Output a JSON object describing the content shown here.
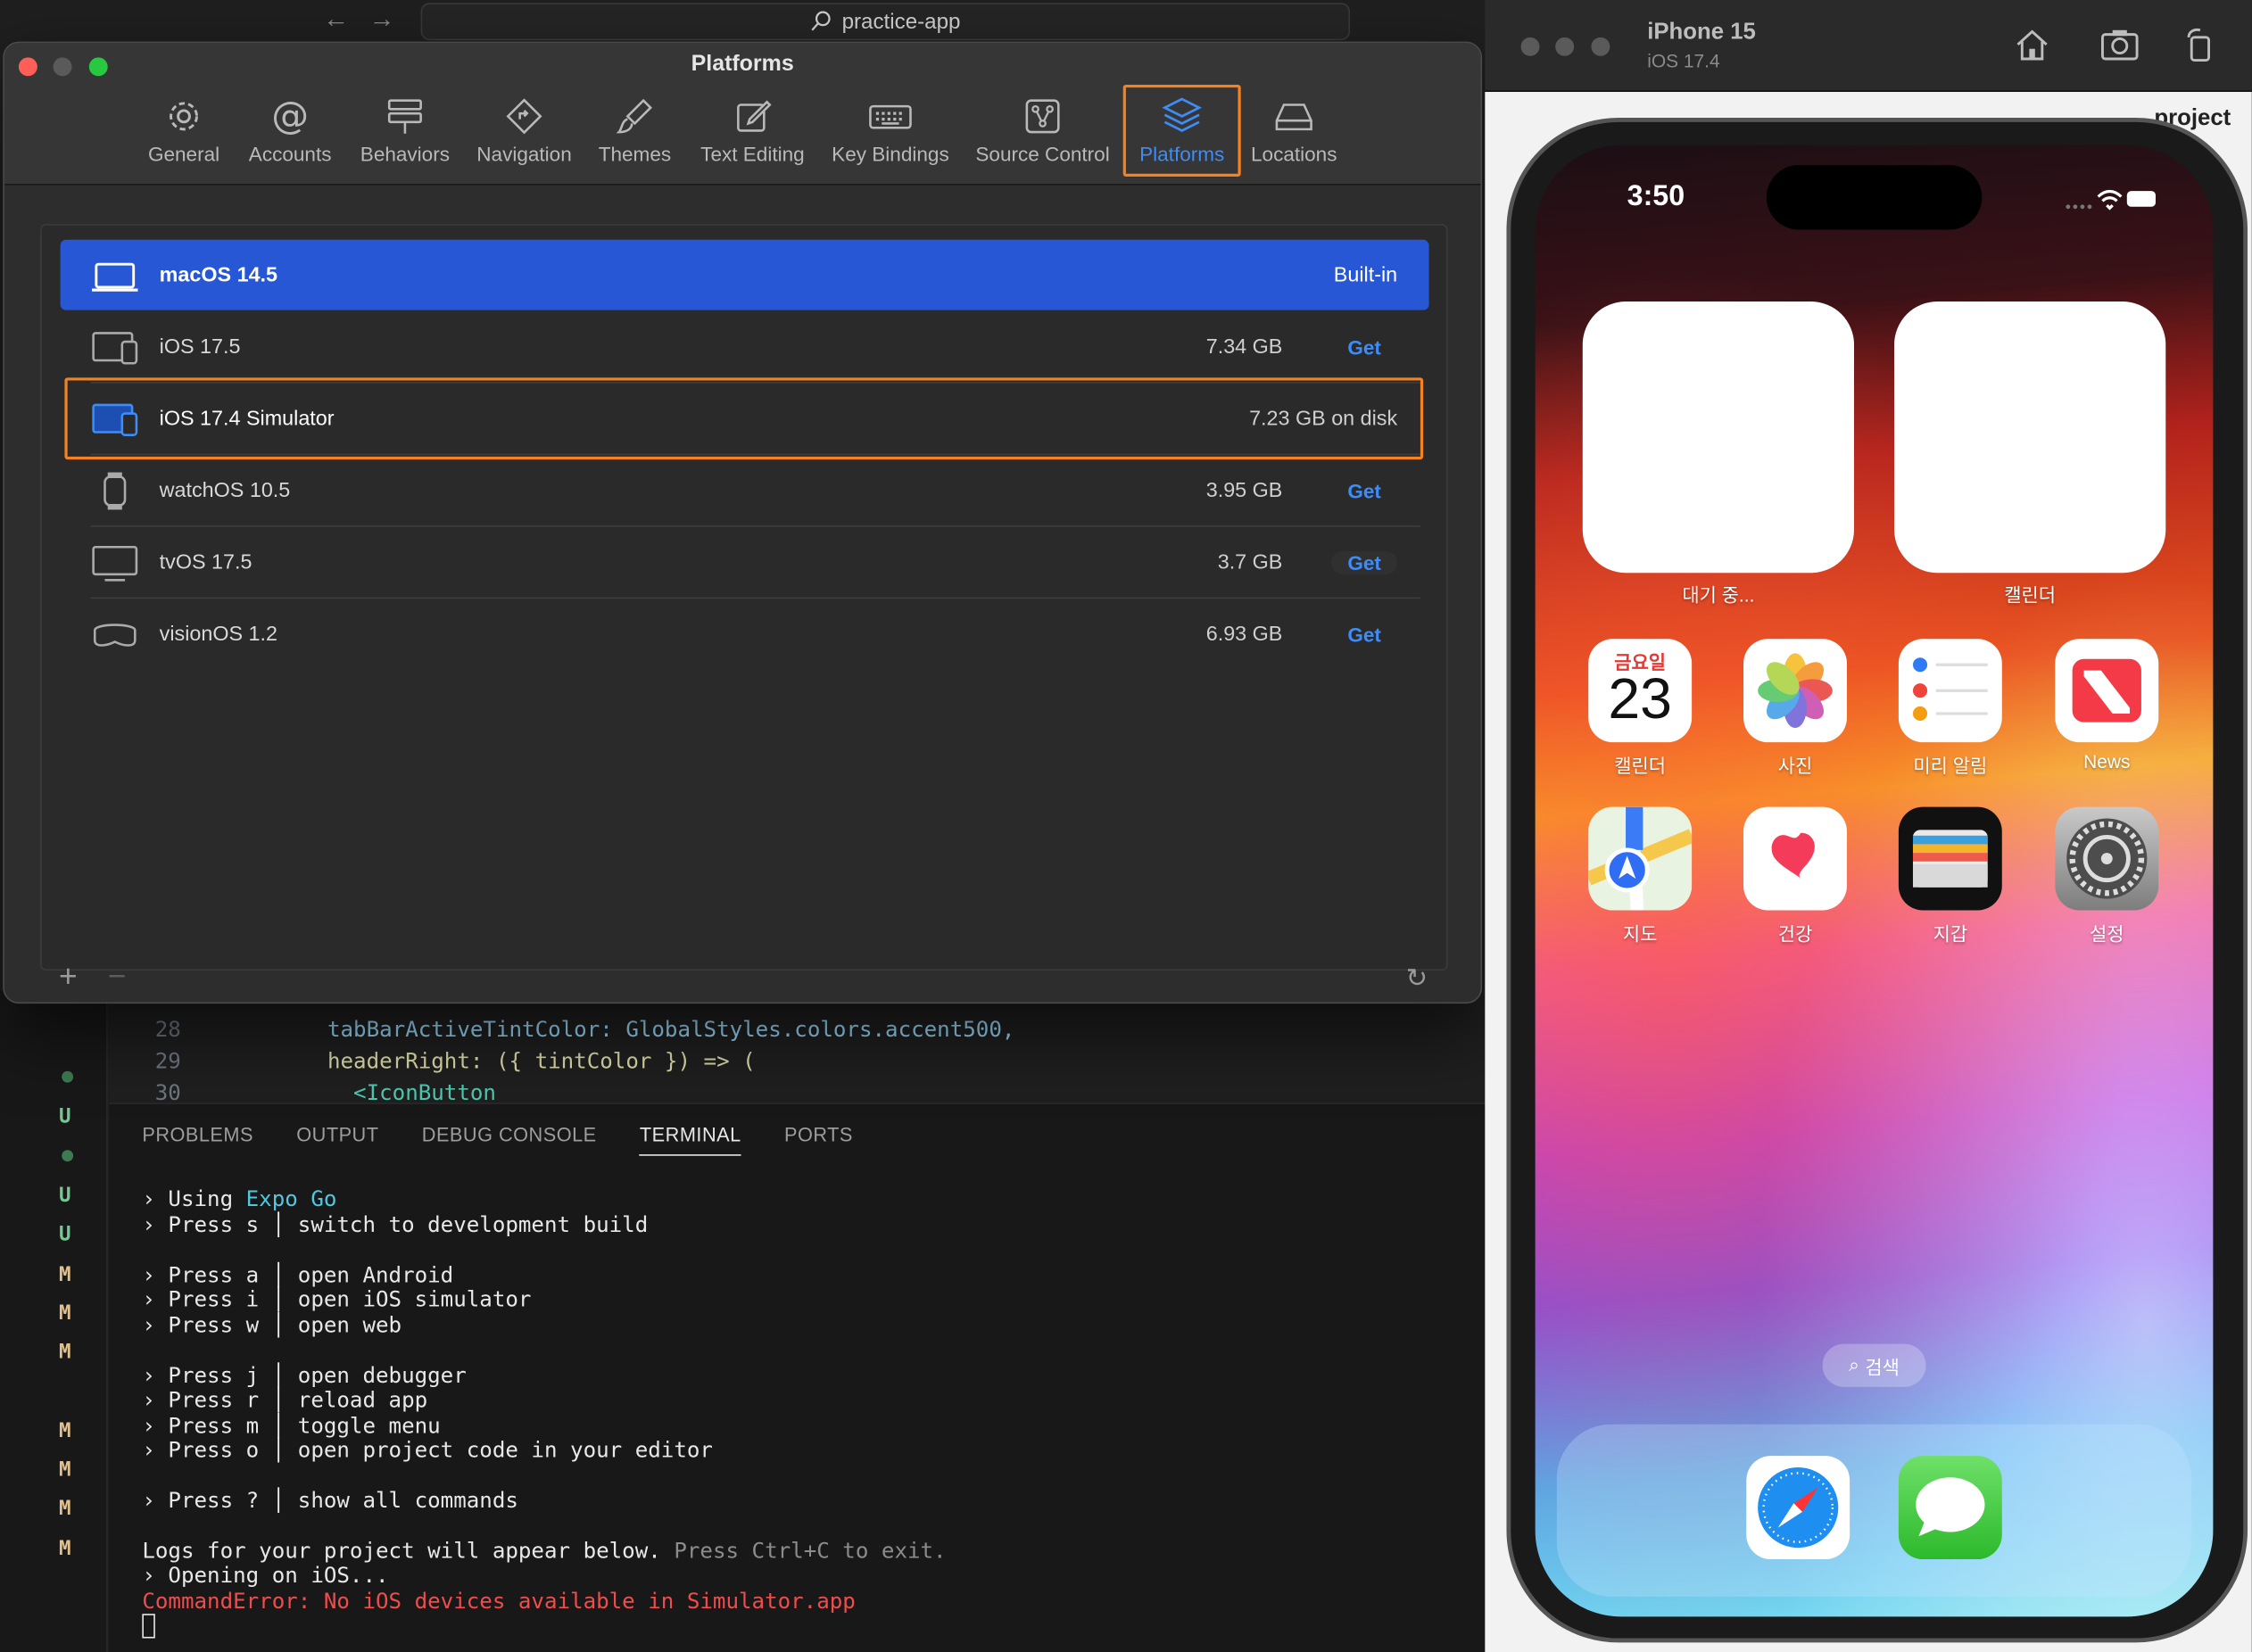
{
  "vscode": {
    "search_text": "practice-app",
    "back_arrow": "←",
    "forward_arrow": "→",
    "editor_lines": [
      {
        "num": "28",
        "code": "tabBarActiveTintColor: GlobalStyles.colors.accent500,"
      },
      {
        "num": "29",
        "code": "headerRight: ({ tintColor }) => ("
      },
      {
        "num": "30",
        "code": "  <IconButton"
      }
    ],
    "git_marks": [
      "U",
      "U",
      "U",
      "M",
      "M",
      "M",
      "M",
      "M",
      "M",
      "M"
    ],
    "panel_tabs": [
      "PROBLEMS",
      "OUTPUT",
      "DEBUG CONSOLE",
      "TERMINAL",
      "PORTS"
    ],
    "active_tab": "TERMINAL",
    "terminal": {
      "using_prefix": "› Using ",
      "using_value": "Expo Go",
      "press_s": "› Press s │ switch to development build",
      "press_a": "› Press a │ open Android",
      "press_i": "› Press i │ open iOS simulator",
      "press_w": "› Press w │ open web",
      "press_j": "› Press j │ open debugger",
      "press_r": "› Press r │ reload app",
      "press_m": "› Press m │ toggle menu",
      "press_o": "› Press o │ open project code in your editor",
      "press_q": "› Press ? │ show all commands",
      "logs_main": "Logs for your project will appear below. ",
      "logs_hint": "Press Ctrl+C to exit.",
      "opening": "› Opening on iOS...",
      "error": "CommandError: No iOS devices available in Simulator.app"
    }
  },
  "settings": {
    "title": "Platforms",
    "toolbar": [
      {
        "label": "General",
        "icon": "gear-icon"
      },
      {
        "label": "Accounts",
        "icon": "at-icon"
      },
      {
        "label": "Behaviors",
        "icon": "behaviors-icon"
      },
      {
        "label": "Navigation",
        "icon": "navigation-icon"
      },
      {
        "label": "Themes",
        "icon": "brush-icon"
      },
      {
        "label": "Text Editing",
        "icon": "pencil-icon"
      },
      {
        "label": "Key Bindings",
        "icon": "keyboard-icon"
      },
      {
        "label": "Source Control",
        "icon": "source-control-icon"
      },
      {
        "label": "Platforms",
        "icon": "layers-icon"
      },
      {
        "label": "Locations",
        "icon": "drive-icon"
      }
    ],
    "selected_tab": "Platforms",
    "platforms": [
      {
        "name": "macOS 14.5",
        "size": "",
        "action": "Built-in",
        "icon": "laptop-icon"
      },
      {
        "name": "iOS 17.5",
        "size": "7.34 GB",
        "action": "Get",
        "icon": "ios-device-icon"
      },
      {
        "name": "iOS 17.4 Simulator",
        "size": "7.23 GB on disk",
        "action": "",
        "icon": "ios-simulator-icon"
      },
      {
        "name": "watchOS 10.5",
        "size": "3.95 GB",
        "action": "Get",
        "icon": "watch-icon"
      },
      {
        "name": "tvOS 17.5",
        "size": "3.7 GB",
        "action": "Get",
        "icon": "tv-icon"
      },
      {
        "name": "visionOS 1.2",
        "size": "6.93 GB",
        "action": "Get",
        "icon": "vision-icon"
      }
    ],
    "add_symbol": "+",
    "remove_symbol": "−",
    "refresh_symbol": "↻"
  },
  "simulator": {
    "device_name": "iPhone 15",
    "os_version": "iOS 17.4",
    "time": "3:50",
    "widgets": [
      {
        "label": "대기 중..."
      },
      {
        "label": "캘린더"
      }
    ],
    "calendar_day_name": "금요일",
    "calendar_day": "23",
    "apps_row1": [
      "캘린더",
      "사진",
      "미리 알림",
      "News"
    ],
    "apps_row2": [
      "지도",
      "건강",
      "지갑",
      "설정"
    ],
    "search_label": "검색",
    "dock_apps": [
      "Safari",
      "Messages"
    ],
    "bg_text": "project"
  },
  "colors": {
    "accent_blue": "#3e8cf7",
    "selection_blue": "#2857d6",
    "highlight_orange": "#f58220",
    "error_red": "#f14c4c"
  }
}
